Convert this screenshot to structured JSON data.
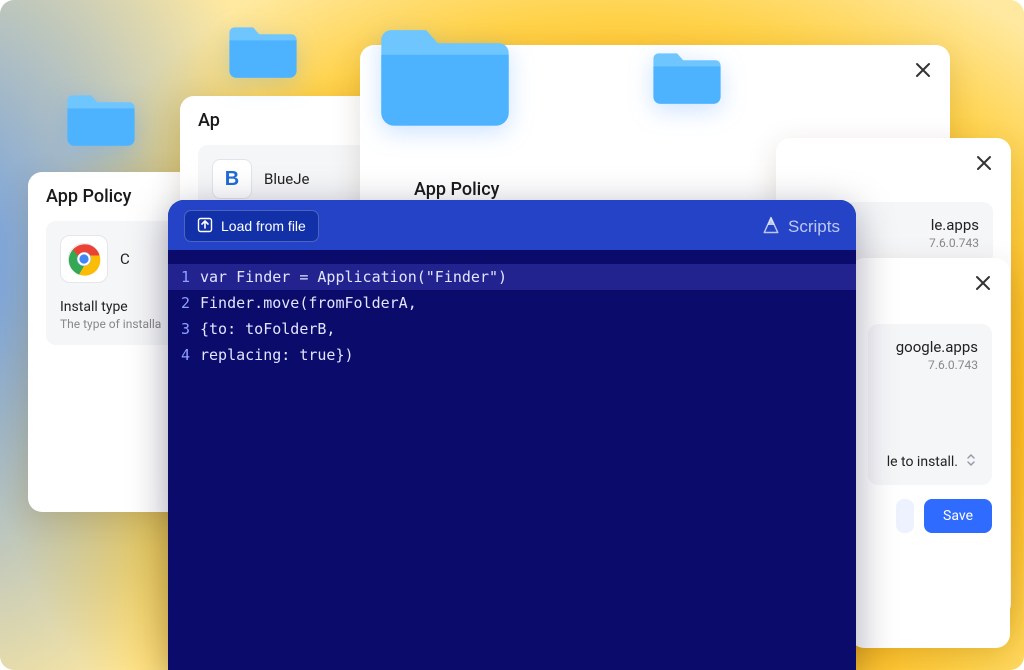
{
  "icons": {
    "close": "close-icon",
    "upload": "upload-icon",
    "folder": "folder-icon",
    "scripts_brand": "scripts-brand-icon",
    "chevron_updown": "chevron-updown-icon"
  },
  "cards": {
    "a": {
      "title": "App Policy",
      "app": {
        "name_partial": "C",
        "icon": "chrome-icon"
      },
      "install": {
        "label": "Install type",
        "caption_partial": "The type of installa"
      }
    },
    "b": {
      "title_partial": "Ap",
      "app": {
        "name_partial": "BlueJe",
        "icon": "bluejeans-icon",
        "monogram": "B"
      }
    },
    "c": {
      "title": "App Policy"
    },
    "d": {
      "app": {
        "name_partial": "le.apps",
        "version_partial": "7.6.0.743"
      }
    },
    "e": {
      "app": {
        "name_partial": "google.apps",
        "version": "7.6.0.743"
      },
      "select_partial": "le to install.",
      "buttons": {
        "save": "Save"
      }
    }
  },
  "scripts": {
    "load_label": "Load from file",
    "brand": "Scripts",
    "code": {
      "1": "var Finder = Application(\"Finder\")",
      "2": "Finder.move(fromFolderA,",
      "3": "{to: toFolderB,",
      "4": "replacing: true})"
    }
  },
  "colors": {
    "accentBlue": "#2f6bff",
    "editorBg": "#0b0b6b",
    "editorHeader": "#2443c6",
    "folderLight": "#6fc6ff",
    "folderDark": "#4db3ff"
  }
}
